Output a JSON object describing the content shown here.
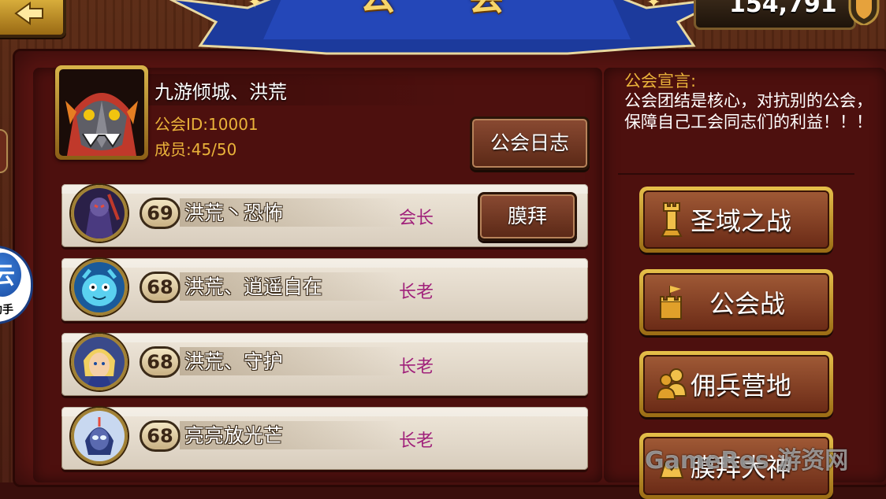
{
  "header": {
    "title": "公 会",
    "gold_amount": "154,791"
  },
  "side": {
    "badge_char": "云",
    "badge_label": "助手"
  },
  "guild": {
    "name": "九游倾城、洪荒",
    "id_text": "公会ID:10001",
    "members_text": "成员:45/50",
    "log_button": "公会日志"
  },
  "members": [
    {
      "level": "69",
      "name": "洪荒丶恐怖",
      "rank": "会长",
      "action": "膜拜"
    },
    {
      "level": "68",
      "name": "洪荒、逍遥自在",
      "rank": "长老"
    },
    {
      "level": "68",
      "name": "洪荒、守护",
      "rank": "长老"
    },
    {
      "level": "68",
      "name": "亮亮放光芒",
      "rank": "长老"
    }
  ],
  "manifesto": {
    "title": "公会宣言:",
    "text": "公会团结是核心，对抗别的公会，保障自己工会同志们的利益！！！"
  },
  "actions": {
    "holy_war": "圣域之战",
    "guild_war": "公会战",
    "mercenary_camp": "佣兵营地",
    "worship_god": "膜拜大神"
  },
  "watermark": "GameRes 游资网",
  "colors": {
    "panel": "#5c1512",
    "gold_text": "#e9b23a",
    "rank_text": "#a0207a"
  }
}
